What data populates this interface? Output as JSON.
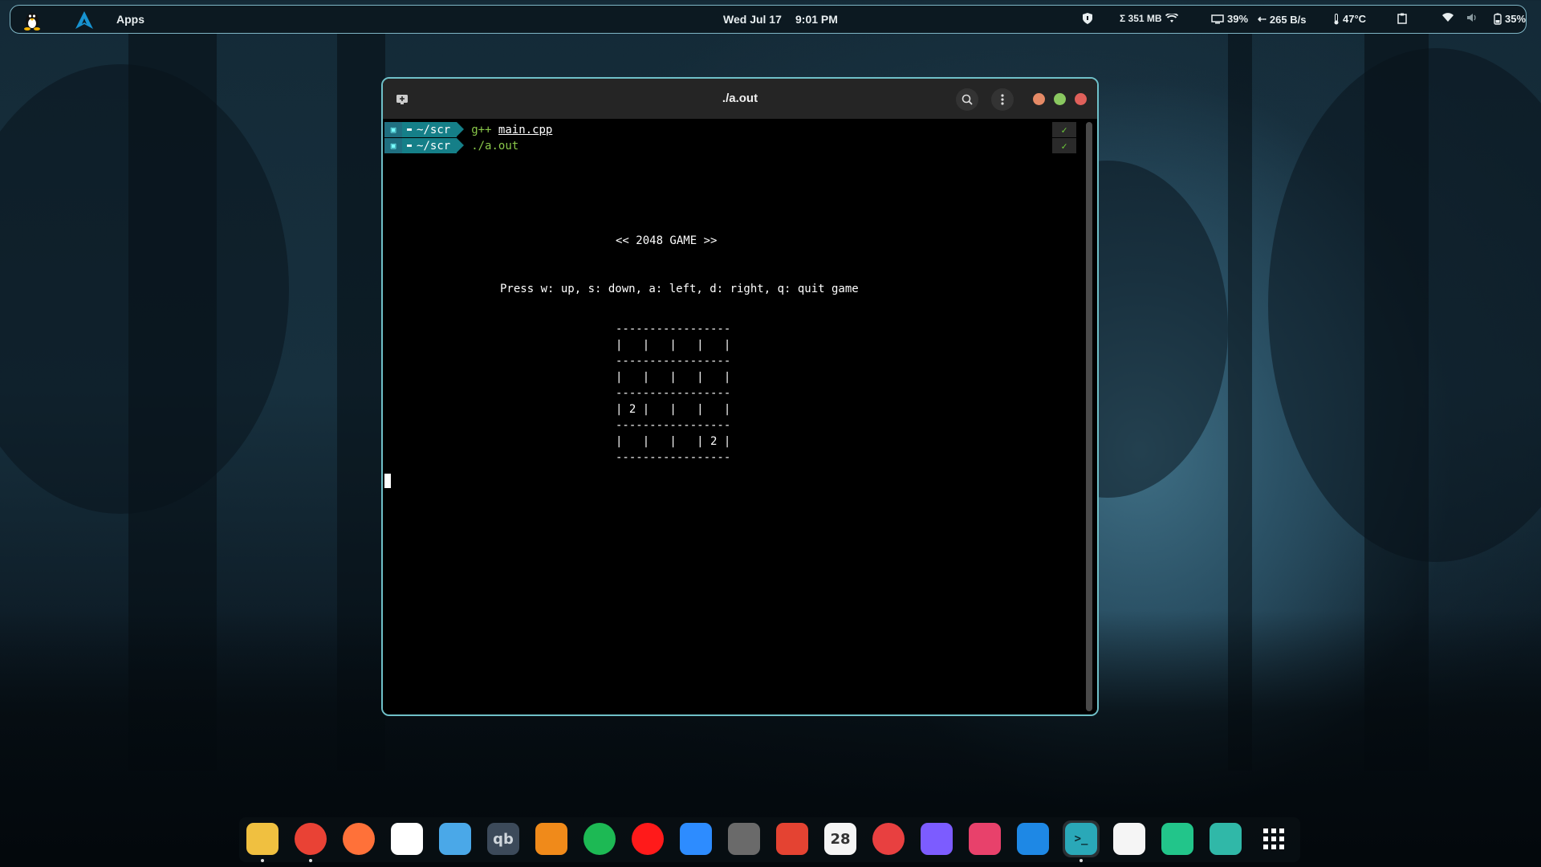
{
  "topbar": {
    "apps_label": "Apps",
    "date": "Wed Jul 17",
    "time": "9:01 PM",
    "memory": "Σ 351 MB",
    "cpu": "39%",
    "network": "265 B/s",
    "temperature": "47°C",
    "battery": "35%"
  },
  "window": {
    "title": "./a.out",
    "close_color": "#e0605a",
    "minimize_color": "#e58a66",
    "maximize_color": "#8ac860"
  },
  "terminal": {
    "prompts": [
      {
        "dir": "~/scr",
        "command": "g++",
        "arg": "main.cpp",
        "status": "✓"
      },
      {
        "dir": "~/scr",
        "command": "./a.out",
        "arg": "",
        "status": "✓"
      }
    ],
    "game_title": "<< 2048 GAME >>",
    "instructions": "Press w: up, s: down, a: left, d: right, q: quit game",
    "board_border": "-----------------",
    "board_rows": [
      "|   |   |   |   |",
      "|   |   |   |   |",
      "| 2 |   |   |   |",
      "|   |   |   | 2 |"
    ]
  },
  "dock": {
    "items": [
      {
        "name": "files",
        "glyph": "",
        "color": "#f0c040"
      },
      {
        "name": "chrome",
        "glyph": "",
        "color": "#e94235"
      },
      {
        "name": "firefox",
        "glyph": "",
        "color": "#ff7139"
      },
      {
        "name": "chatgpt",
        "glyph": "",
        "color": "#ffffff"
      },
      {
        "name": "mail",
        "glyph": "",
        "color": "#4aa8e8"
      },
      {
        "name": "qbittorrent",
        "glyph": "qb",
        "color": "#3c4a5a"
      },
      {
        "name": "vlc",
        "glyph": "",
        "color": "#f08a1a"
      },
      {
        "name": "spotify",
        "glyph": "",
        "color": "#1db954"
      },
      {
        "name": "youtube-music",
        "glyph": "",
        "color": "#ff1a1a"
      },
      {
        "name": "zoom",
        "glyph": "",
        "color": "#2d8cff"
      },
      {
        "name": "camera",
        "glyph": "",
        "color": "#6a6a6a"
      },
      {
        "name": "todoist",
        "glyph": "",
        "color": "#e44332"
      },
      {
        "name": "calendar",
        "glyph": "28",
        "color": "#f5f5f5"
      },
      {
        "name": "obs",
        "glyph": "",
        "color": "#e84040"
      },
      {
        "name": "obsidian",
        "glyph": "",
        "color": "#7c5cff"
      },
      {
        "name": "github",
        "glyph": "",
        "color": "#e8416b"
      },
      {
        "name": "vscode",
        "glyph": "",
        "color": "#1e88e5"
      },
      {
        "name": "terminal",
        "glyph": ">_",
        "color": "#2aa8b8"
      },
      {
        "name": "text-editor",
        "glyph": "",
        "color": "#f5f5f5"
      },
      {
        "name": "downloader",
        "glyph": "",
        "color": "#22c58a"
      },
      {
        "name": "recycle",
        "glyph": "",
        "color": "#30b8a8"
      },
      {
        "name": "app-grid",
        "glyph": "",
        "color": "#ffffff"
      }
    ]
  }
}
